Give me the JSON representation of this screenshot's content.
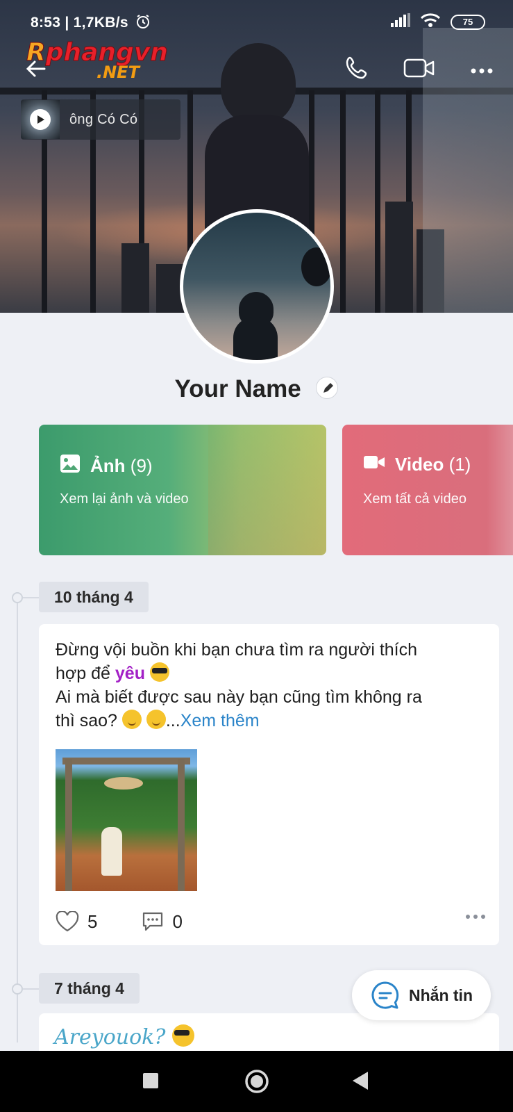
{
  "status_bar": {
    "time": "8:53",
    "speed": "| 1,7KB/s",
    "battery": "75"
  },
  "watermark": {
    "line1_a": "R",
    "line1_b": "phangvn",
    "line2": ".NET"
  },
  "music": {
    "label": "ông Có        Có"
  },
  "profile": {
    "name": "Your Name"
  },
  "media": {
    "photos_title": "Ảnh",
    "photos_count": "(9)",
    "photos_sub": "Xem lại ảnh và video",
    "videos_title": "Video",
    "videos_count": "(1)",
    "videos_sub": "Xem tất cả video"
  },
  "timeline": [
    {
      "date": "10 tháng 4",
      "text_line1": "Đừng vội buồn khi bạn chưa tìm ra người thích",
      "text_line2a": "hợp để ",
      "text_highlight": "yêu",
      "text_line3": "Ai mà biết được sau này bạn cũng tìm không ra",
      "text_line4a": "thì sao? ",
      "text_ellipsis": "...",
      "see_more": "Xem thêm",
      "likes": "5",
      "comments": "0"
    },
    {
      "date": "7 tháng 4",
      "text": "Areyouok?"
    }
  ],
  "fab": {
    "label": "Nhắn tin"
  },
  "colors": {
    "photos_card": "#4ea674",
    "videos_card": "#de6b7a",
    "highlight": "#a320c6",
    "link": "#2a84c9"
  }
}
